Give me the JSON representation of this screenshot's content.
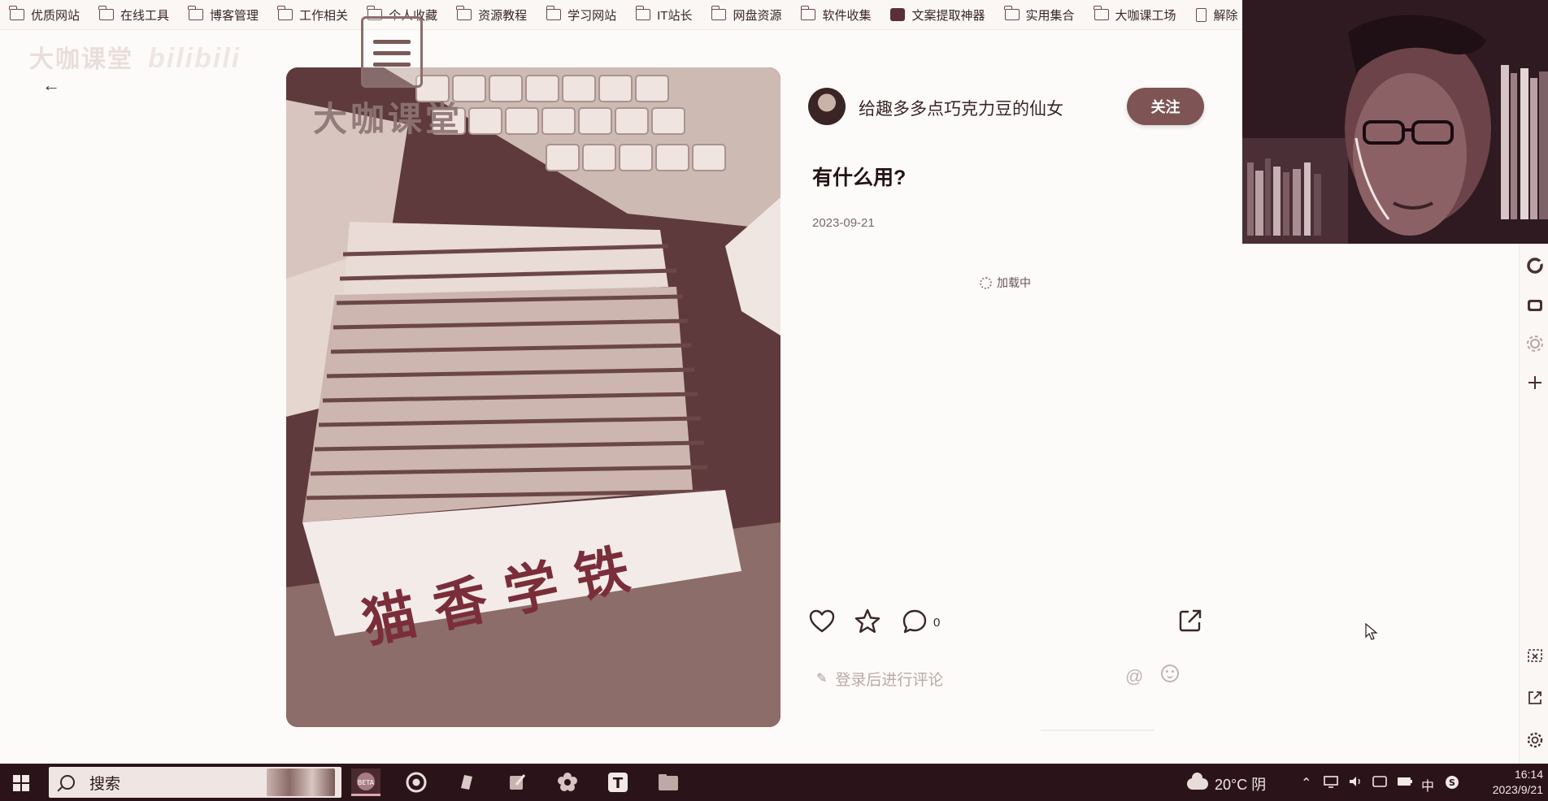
{
  "bookmarks": [
    {
      "label": "优质网站",
      "icon": "folder-icon"
    },
    {
      "label": "在线工具",
      "icon": "folder-icon"
    },
    {
      "label": "博客管理",
      "icon": "folder-icon"
    },
    {
      "label": "工作相关",
      "icon": "folder-icon"
    },
    {
      "label": "个人收藏",
      "icon": "folder-icon"
    },
    {
      "label": "资源教程",
      "icon": "folder-icon"
    },
    {
      "label": "学习网站",
      "icon": "folder-icon"
    },
    {
      "label": "IT站长",
      "icon": "folder-icon"
    },
    {
      "label": "网盘资源",
      "icon": "folder-icon"
    },
    {
      "label": "软件收集",
      "icon": "folder-icon"
    },
    {
      "label": "文案提取神器",
      "icon": "app-icon"
    },
    {
      "label": "实用集合",
      "icon": "folder-icon"
    },
    {
      "label": "大咖课工场",
      "icon": "folder-icon"
    },
    {
      "label": "解除",
      "icon": "doc-icon"
    }
  ],
  "watermark": {
    "text": "大咖课堂",
    "bili": "bilibili"
  },
  "post": {
    "image_logo_text": "大咖课堂",
    "author_name": "给趣多多点巧克力豆的仙女",
    "follow_label": "关注",
    "title": "有什么用?",
    "date": "2023-09-21",
    "loading_text": "加载中",
    "comment_count": "0",
    "comment_placeholder": "登录后进行评论"
  },
  "taskbar": {
    "search_label": "搜索",
    "weather": "20°C 阴",
    "ime": "中",
    "time": "16:14",
    "date": "2023/9/21"
  },
  "colors": {
    "accent": "#7e5454",
    "taskbar": "#2b1419",
    "background": "#fdfbfa"
  }
}
